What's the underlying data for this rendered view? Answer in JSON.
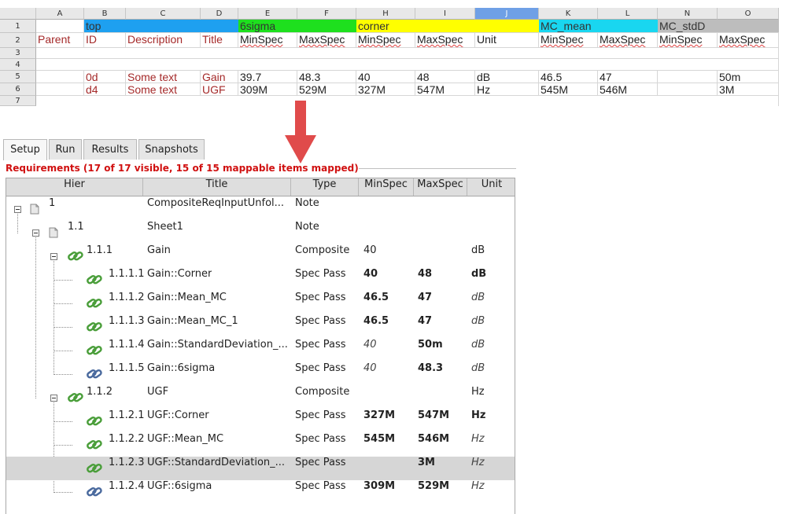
{
  "spreadsheet": {
    "columns": [
      "A",
      "B",
      "C",
      "D",
      "E",
      "F",
      "H",
      "I",
      "J",
      "K",
      "L",
      "N",
      "O"
    ],
    "rows": [
      "1",
      "2",
      "3",
      "4",
      "5",
      "6",
      "7"
    ],
    "row1_bands": {
      "top": "top",
      "sigma6": "6sigma",
      "corner": "corner",
      "mc_mean": "MC_mean",
      "mc_stdd": "MC_stdD"
    },
    "row2": [
      "Parent",
      "ID",
      "Description",
      "Title",
      "MinSpec",
      "MaxSpec",
      "MinSpec",
      "MaxSpec",
      "Unit",
      "MinSpec",
      "MaxSpec",
      "MinSpec",
      "MaxSpec"
    ],
    "row5": [
      "",
      "0d",
      "Some text",
      "Gain",
      "39.7",
      "48.3",
      "40",
      "48",
      "dB",
      "46.5",
      "47",
      "",
      "50m"
    ],
    "row6": [
      "",
      "d4",
      "Some text",
      "UGF",
      "309M",
      "529M",
      "327M",
      "547M",
      "Hz",
      "545M",
      "546M",
      "",
      "3M"
    ],
    "band_colors": {
      "top": "#1ea0f0",
      "sigma6": "#1ee01e",
      "corner": "#ffff00",
      "mc_mean": "#19d6f0",
      "mc_stdd": "#bdbdbd"
    }
  },
  "tabs": [
    "Setup",
    "Run",
    "Results",
    "Snapshots"
  ],
  "requirements_title": "Requirements (17 of 17 visible, 15 of 15 mappable items mapped)",
  "table": {
    "headers": [
      "Hier",
      "Title",
      "Type",
      "MinSpec",
      "MaxSpec",
      "Unit"
    ],
    "rows": [
      {
        "hier": "1",
        "title": "CompositeReqInputUnfol...",
        "type": "Note",
        "min": "",
        "max": "",
        "unit": ""
      },
      {
        "hier": "1.1",
        "title": "Sheet1",
        "type": "Note",
        "min": "",
        "max": "",
        "unit": ""
      },
      {
        "hier": "1.1.1",
        "title": "Gain",
        "type": "Composite",
        "min": "40",
        "max": "",
        "unit": "dB"
      },
      {
        "hier": "1.1.1.1",
        "title": "Gain::Corner",
        "type": "Spec Pass",
        "min": "40",
        "max": "48",
        "unit": "dB"
      },
      {
        "hier": "1.1.1.2",
        "title": "Gain::Mean_MC",
        "type": "Spec Pass",
        "min": "46.5",
        "max": "47",
        "unit": "dB"
      },
      {
        "hier": "1.1.1.3",
        "title": "Gain::Mean_MC_1",
        "type": "Spec Pass",
        "min": "46.5",
        "max": "47",
        "unit": "dB"
      },
      {
        "hier": "1.1.1.4",
        "title": "Gain::StandardDeviation_...",
        "type": "Spec Pass",
        "min": "40",
        "max": "50m",
        "unit": "dB"
      },
      {
        "hier": "1.1.1.5",
        "title": "Gain::6sigma",
        "type": "Spec Pass",
        "min": "40",
        "max": "48.3",
        "unit": "dB"
      },
      {
        "hier": "1.1.2",
        "title": "UGF",
        "type": "Composite",
        "min": "",
        "max": "",
        "unit": "Hz"
      },
      {
        "hier": "1.1.2.1",
        "title": "UGF::Corner",
        "type": "Spec Pass",
        "min": "327M",
        "max": "547M",
        "unit": "Hz"
      },
      {
        "hier": "1.1.2.2",
        "title": "UGF::Mean_MC",
        "type": "Spec Pass",
        "min": "545M",
        "max": "546M",
        "unit": "Hz"
      },
      {
        "hier": "1.1.2.3",
        "title": "UGF::StandardDeviation_...",
        "type": "Spec Pass",
        "min": "",
        "max": "3M",
        "unit": "Hz"
      },
      {
        "hier": "1.1.2.4",
        "title": "UGF::6sigma",
        "type": "Spec Pass",
        "min": "309M",
        "max": "529M",
        "unit": "Hz"
      }
    ]
  }
}
